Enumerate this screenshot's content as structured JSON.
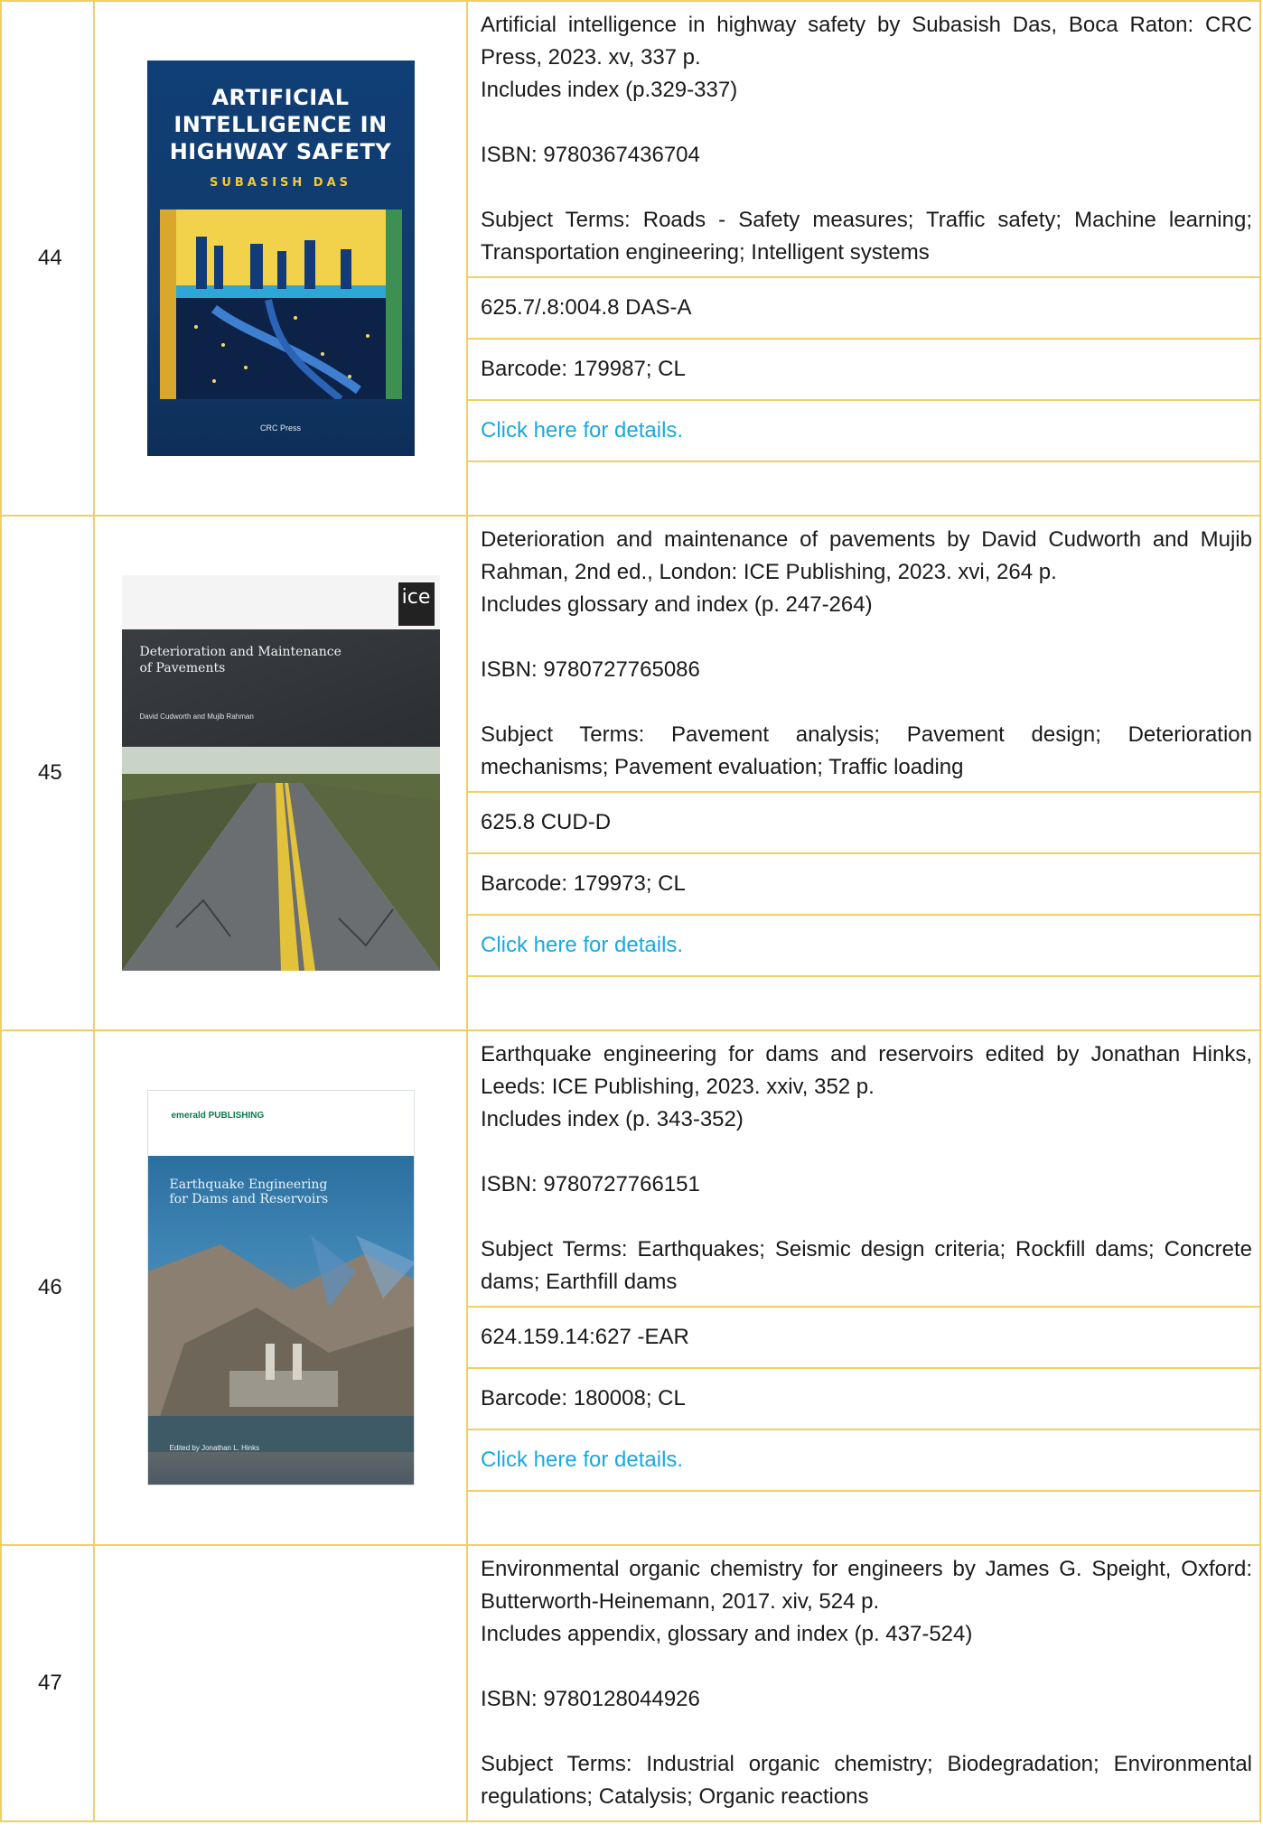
{
  "entries": [
    {
      "number": "44",
      "cover": {
        "title_lines": [
          "ARTIFICIAL",
          "INTELLIGENCE IN",
          "HIGHWAY SAFETY"
        ],
        "author": "SUBASISH DAS",
        "publisher": "CRC Press"
      },
      "citation": "Artificial intelligence in highway safety by Subasish Das, Boca Raton: CRC Press, 2023. xv, 337 p.",
      "notes": "Includes index (p.329-337)",
      "isbn": "ISBN: 9780367436704",
      "subjects": "Subject Terms: Roads - Safety measures; Traffic safety; Machine learning; Transportation engineering; Intelligent systems",
      "call_number": "625.7/.8:004.8 DAS-A",
      "barcode": "Barcode: 179987; CL",
      "link_label": "Click here for details."
    },
    {
      "number": "45",
      "cover": {
        "brand": "ice",
        "title_lines": [
          "Deterioration and Maintenance",
          "of Pavements"
        ],
        "authors": "David Cudworth and Mujib Rahman"
      },
      "citation": "Deterioration and maintenance of pavements by David Cudworth and Mujib Rahman, 2nd ed., London: ICE Publishing, 2023. xvi, 264 p.",
      "notes": "Includes glossary and index (p. 247-264)",
      "isbn": "ISBN: 9780727765086",
      "subjects": "Subject Terms: Pavement analysis; Pavement design; Deterioration mechanisms; Pavement evaluation; Traffic loading",
      "call_number": "625.8 CUD-D",
      "barcode": "Barcode: 179973; CL",
      "link_label": "Click here for details."
    },
    {
      "number": "46",
      "cover": {
        "brand": "emerald PUBLISHING",
        "title_lines": [
          "Earthquake Engineering",
          "for Dams and Reservoirs"
        ],
        "editor": "Edited by Jonathan L. Hinks"
      },
      "citation": "Earthquake engineering for dams and reservoirs edited by Jonathan Hinks, Leeds: ICE Publishing, 2023. xxiv, 352 p.",
      "notes": "Includes index (p. 343-352)",
      "isbn": "ISBN: 9780727766151",
      "subjects": "Subject Terms: Earthquakes; Seismic design criteria; Rockfill dams; Concrete dams; Earthfill dams",
      "call_number": "624.159.14:627 -EAR",
      "barcode": "Barcode: 180008; CL",
      "link_label": "Click here for details."
    },
    {
      "number": "47",
      "citation": "Environmental organic chemistry for engineers by James G. Speight, Oxford: Butterworth-Heinemann, 2017. xiv, 524 p.",
      "notes": "Includes appendix, glossary and index (p. 437-524)",
      "isbn": "ISBN: 9780128044926",
      "subjects": "Subject Terms: Industrial organic chemistry; Biodegradation; Environmental regulations; Catalysis; Organic reactions"
    }
  ],
  "colors": {
    "border": "#f3cf63",
    "link": "#1aa8e0"
  }
}
